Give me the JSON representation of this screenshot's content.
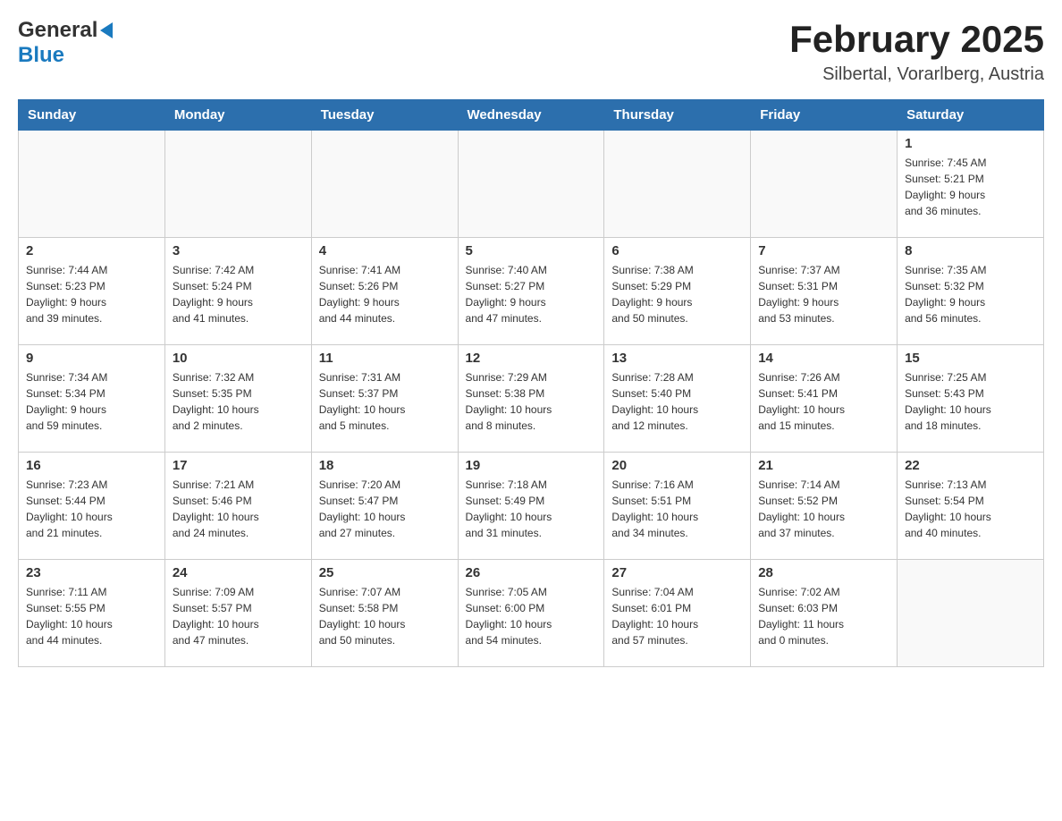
{
  "header": {
    "month_title": "February 2025",
    "subtitle": "Silbertal, Vorarlberg, Austria",
    "logo_general": "General",
    "logo_blue": "Blue"
  },
  "weekdays": [
    "Sunday",
    "Monday",
    "Tuesday",
    "Wednesday",
    "Thursday",
    "Friday",
    "Saturday"
  ],
  "weeks": [
    [
      {
        "day": "",
        "info": ""
      },
      {
        "day": "",
        "info": ""
      },
      {
        "day": "",
        "info": ""
      },
      {
        "day": "",
        "info": ""
      },
      {
        "day": "",
        "info": ""
      },
      {
        "day": "",
        "info": ""
      },
      {
        "day": "1",
        "info": "Sunrise: 7:45 AM\nSunset: 5:21 PM\nDaylight: 9 hours\nand 36 minutes."
      }
    ],
    [
      {
        "day": "2",
        "info": "Sunrise: 7:44 AM\nSunset: 5:23 PM\nDaylight: 9 hours\nand 39 minutes."
      },
      {
        "day": "3",
        "info": "Sunrise: 7:42 AM\nSunset: 5:24 PM\nDaylight: 9 hours\nand 41 minutes."
      },
      {
        "day": "4",
        "info": "Sunrise: 7:41 AM\nSunset: 5:26 PM\nDaylight: 9 hours\nand 44 minutes."
      },
      {
        "day": "5",
        "info": "Sunrise: 7:40 AM\nSunset: 5:27 PM\nDaylight: 9 hours\nand 47 minutes."
      },
      {
        "day": "6",
        "info": "Sunrise: 7:38 AM\nSunset: 5:29 PM\nDaylight: 9 hours\nand 50 minutes."
      },
      {
        "day": "7",
        "info": "Sunrise: 7:37 AM\nSunset: 5:31 PM\nDaylight: 9 hours\nand 53 minutes."
      },
      {
        "day": "8",
        "info": "Sunrise: 7:35 AM\nSunset: 5:32 PM\nDaylight: 9 hours\nand 56 minutes."
      }
    ],
    [
      {
        "day": "9",
        "info": "Sunrise: 7:34 AM\nSunset: 5:34 PM\nDaylight: 9 hours\nand 59 minutes."
      },
      {
        "day": "10",
        "info": "Sunrise: 7:32 AM\nSunset: 5:35 PM\nDaylight: 10 hours\nand 2 minutes."
      },
      {
        "day": "11",
        "info": "Sunrise: 7:31 AM\nSunset: 5:37 PM\nDaylight: 10 hours\nand 5 minutes."
      },
      {
        "day": "12",
        "info": "Sunrise: 7:29 AM\nSunset: 5:38 PM\nDaylight: 10 hours\nand 8 minutes."
      },
      {
        "day": "13",
        "info": "Sunrise: 7:28 AM\nSunset: 5:40 PM\nDaylight: 10 hours\nand 12 minutes."
      },
      {
        "day": "14",
        "info": "Sunrise: 7:26 AM\nSunset: 5:41 PM\nDaylight: 10 hours\nand 15 minutes."
      },
      {
        "day": "15",
        "info": "Sunrise: 7:25 AM\nSunset: 5:43 PM\nDaylight: 10 hours\nand 18 minutes."
      }
    ],
    [
      {
        "day": "16",
        "info": "Sunrise: 7:23 AM\nSunset: 5:44 PM\nDaylight: 10 hours\nand 21 minutes."
      },
      {
        "day": "17",
        "info": "Sunrise: 7:21 AM\nSunset: 5:46 PM\nDaylight: 10 hours\nand 24 minutes."
      },
      {
        "day": "18",
        "info": "Sunrise: 7:20 AM\nSunset: 5:47 PM\nDaylight: 10 hours\nand 27 minutes."
      },
      {
        "day": "19",
        "info": "Sunrise: 7:18 AM\nSunset: 5:49 PM\nDaylight: 10 hours\nand 31 minutes."
      },
      {
        "day": "20",
        "info": "Sunrise: 7:16 AM\nSunset: 5:51 PM\nDaylight: 10 hours\nand 34 minutes."
      },
      {
        "day": "21",
        "info": "Sunrise: 7:14 AM\nSunset: 5:52 PM\nDaylight: 10 hours\nand 37 minutes."
      },
      {
        "day": "22",
        "info": "Sunrise: 7:13 AM\nSunset: 5:54 PM\nDaylight: 10 hours\nand 40 minutes."
      }
    ],
    [
      {
        "day": "23",
        "info": "Sunrise: 7:11 AM\nSunset: 5:55 PM\nDaylight: 10 hours\nand 44 minutes."
      },
      {
        "day": "24",
        "info": "Sunrise: 7:09 AM\nSunset: 5:57 PM\nDaylight: 10 hours\nand 47 minutes."
      },
      {
        "day": "25",
        "info": "Sunrise: 7:07 AM\nSunset: 5:58 PM\nDaylight: 10 hours\nand 50 minutes."
      },
      {
        "day": "26",
        "info": "Sunrise: 7:05 AM\nSunset: 6:00 PM\nDaylight: 10 hours\nand 54 minutes."
      },
      {
        "day": "27",
        "info": "Sunrise: 7:04 AM\nSunset: 6:01 PM\nDaylight: 10 hours\nand 57 minutes."
      },
      {
        "day": "28",
        "info": "Sunrise: 7:02 AM\nSunset: 6:03 PM\nDaylight: 11 hours\nand 0 minutes."
      },
      {
        "day": "",
        "info": ""
      }
    ]
  ]
}
